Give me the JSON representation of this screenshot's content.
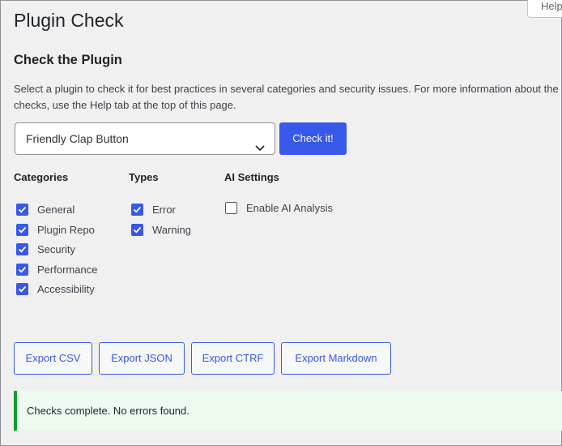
{
  "help_tab": "Help",
  "page_title": "Plugin Check",
  "section_title": "Check the Plugin",
  "description": "Select a plugin to check it for best practices in several categories and security issues. For more information about the checks, use the Help tab at the top of this page.",
  "plugin_select": {
    "value": "Friendly Clap Button"
  },
  "check_button": "Check it!",
  "categories": {
    "title": "Categories",
    "items": [
      {
        "label": "General",
        "checked": true
      },
      {
        "label": "Plugin Repo",
        "checked": true
      },
      {
        "label": "Security",
        "checked": true
      },
      {
        "label": "Performance",
        "checked": true
      },
      {
        "label": "Accessibility",
        "checked": true
      }
    ]
  },
  "types": {
    "title": "Types",
    "items": [
      {
        "label": "Error",
        "checked": true
      },
      {
        "label": "Warning",
        "checked": true
      }
    ]
  },
  "ai_settings": {
    "title": "AI Settings",
    "items": [
      {
        "label": "Enable AI Analysis",
        "checked": false
      }
    ]
  },
  "export_buttons": [
    "Export CSV",
    "Export JSON",
    "Export CTRF",
    "Export Markdown"
  ],
  "notice": "Checks complete. No errors found.",
  "colors": {
    "accent": "#3858e9",
    "success": "#00a32a",
    "notice_bg": "#edfaef"
  }
}
